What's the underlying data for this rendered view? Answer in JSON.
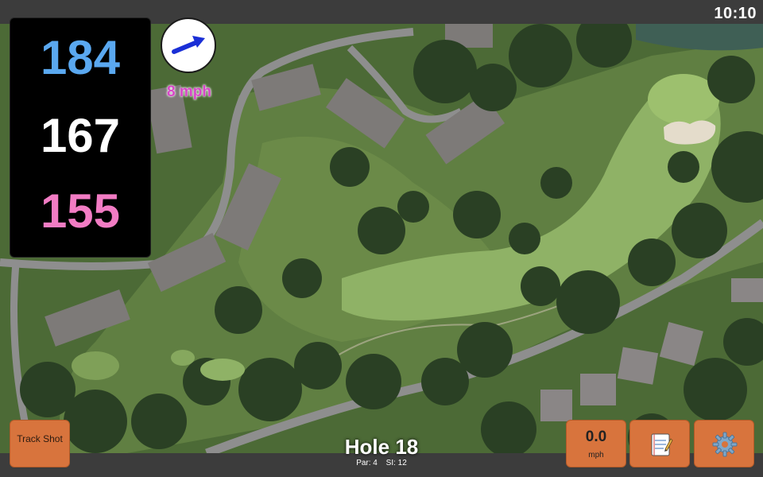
{
  "status_bar": {
    "time": "10:10"
  },
  "distances": {
    "back": "184",
    "middle": "167",
    "front": "155"
  },
  "wind": {
    "speed_label": "8 mph",
    "arrow_icon": "arrow-right-icon"
  },
  "hole": {
    "title": "Hole 18",
    "par_label": "Par: 4",
    "si_label": "SI: 12"
  },
  "buttons": {
    "track_shot": "Track Shot",
    "speed_value": "0.0",
    "speed_unit": "mph",
    "notes_icon": "notepad-icon",
    "settings_icon": "gear-icon"
  },
  "colors": {
    "back_distance": "#5aa8f0",
    "middle_distance": "#ffffff",
    "front_distance": "#f27cc4",
    "wind_text": "#d846c8",
    "button": "#d8743d",
    "bar": "#3c3c3c"
  }
}
